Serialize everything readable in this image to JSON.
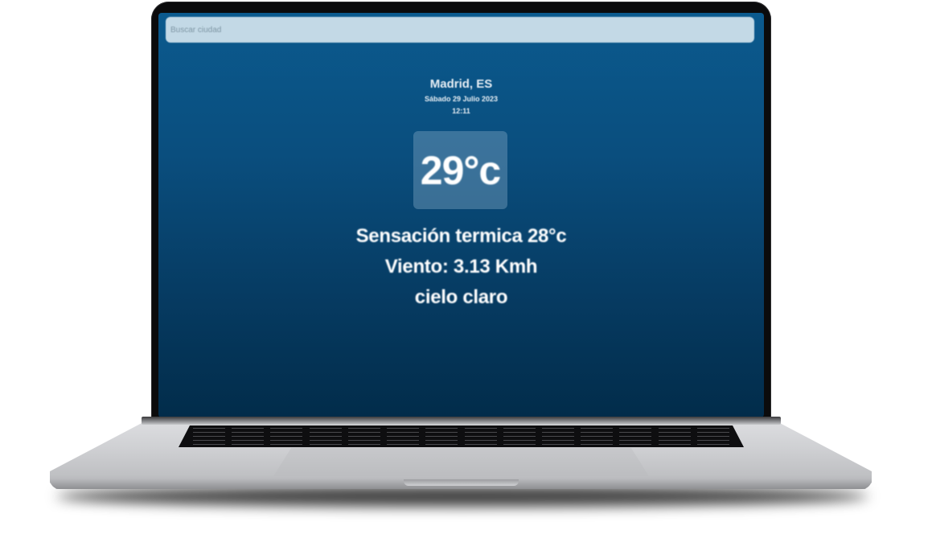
{
  "search": {
    "placeholder": "Buscar ciudad"
  },
  "weather": {
    "location": "Madrid, ES",
    "date": "Sábado 29 Julio 2023",
    "time": "12:11",
    "temperature": "29°c",
    "feels_like": "Sensación termica 28°c",
    "wind": "Viento: 3.13 Kmh",
    "description": "cielo claro"
  },
  "colors": {
    "background_top": "#0b5a8e",
    "background_bottom": "#022c4a",
    "search_bar": "#c3d9e6",
    "text": "#ffffff"
  }
}
